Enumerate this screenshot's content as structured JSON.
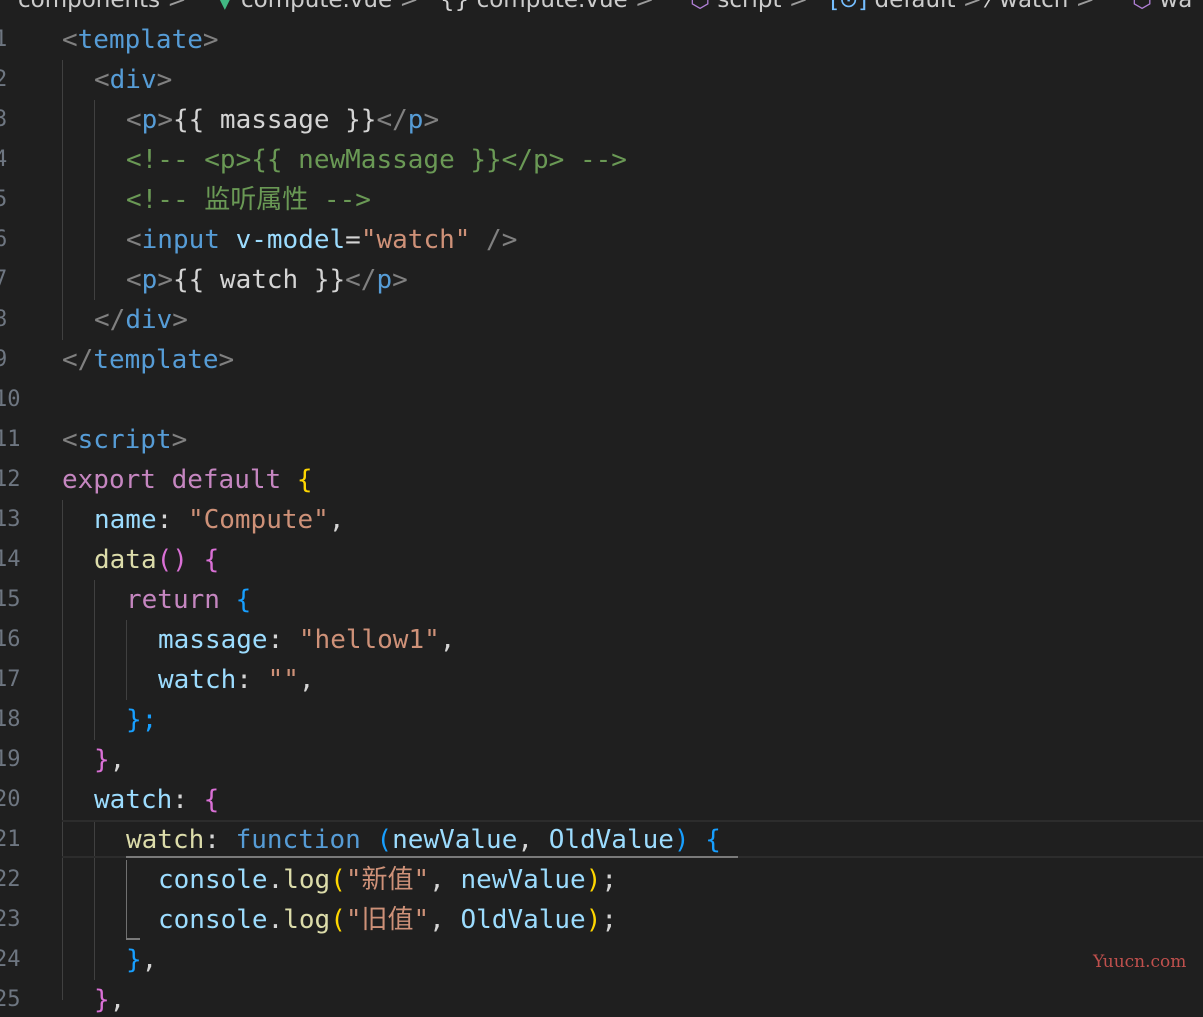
{
  "breadcrumb": {
    "items": [
      {
        "icon": "",
        "label": "components"
      },
      {
        "icon": "vue-logo-icon",
        "glyph": "▼",
        "label": "compute.vue"
      },
      {
        "icon": "braces-icon",
        "glyph": "{}",
        "label": "compute.vue"
      },
      {
        "icon": "cube-icon",
        "glyph": "⬡",
        "label": "script"
      },
      {
        "icon": "module-icon",
        "glyph": "[⊙]",
        "label": "default"
      },
      {
        "icon": "wrench-icon",
        "glyph": "⁄",
        "label": "watch"
      },
      {
        "icon": "cube-icon",
        "glyph": "⬡",
        "label": "wa"
      }
    ],
    "separator": ">"
  },
  "line_numbers": [
    "1",
    "2",
    "3",
    "4",
    "5",
    "6",
    "7",
    "8",
    "9",
    "10",
    "11",
    "12",
    "13",
    "14",
    "15",
    "16",
    "17",
    "18",
    "19",
    "20",
    "21",
    "22",
    "23",
    "24",
    "25"
  ],
  "code": {
    "l1": {
      "a": "<",
      "b": "template",
      "c": ">"
    },
    "l2": {
      "a": "<",
      "b": "div",
      "c": ">"
    },
    "l3": {
      "a": "<",
      "b": "p",
      "c": ">",
      "d": "{{ massage }}",
      "e": "</",
      "f": "p",
      "g": ">"
    },
    "l4": {
      "a": "<!-- <p>{{ newMassage }}</p> -->"
    },
    "l5": {
      "a": "<!-- 监听属性 -->"
    },
    "l6": {
      "a": "<",
      "b": "input",
      "c": " ",
      "d": "v-model",
      "e": "=",
      "f": "\"watch\"",
      "g": " />"
    },
    "l7": {
      "a": "<",
      "b": "p",
      "c": ">",
      "d": "{{ watch }}",
      "e": "</",
      "f": "p",
      "g": ">"
    },
    "l8": {
      "a": "</",
      "b": "div",
      "c": ">"
    },
    "l9": {
      "a": "</",
      "b": "template",
      "c": ">"
    },
    "l11": {
      "a": "<",
      "b": "script",
      "c": ">"
    },
    "l12": {
      "a": "export",
      "b": " ",
      "c": "default",
      "d": " ",
      "e": "{"
    },
    "l13": {
      "a": "name",
      "b": ": ",
      "c": "\"Compute\"",
      "d": ","
    },
    "l14": {
      "a": "data",
      "b": "()",
      "c": " ",
      "d": "{"
    },
    "l15": {
      "a": "return",
      "b": " ",
      "c": "{"
    },
    "l16": {
      "a": "massage",
      "b": ": ",
      "c": "\"hellow1\"",
      "d": ","
    },
    "l17": {
      "a": "watch",
      "b": ": ",
      "c": "\"\"",
      "d": ","
    },
    "l18": {
      "a": "};"
    },
    "l19": {
      "a": "}",
      "b": ","
    },
    "l20": {
      "a": "watch",
      "b": ": ",
      "c": "{"
    },
    "l21": {
      "a": "watch",
      "b": ": ",
      "c": "function",
      "d": " ",
      "e": "(",
      "f": "newValue",
      "g": ", ",
      "h": "OldValue",
      "i": ")",
      "j": " ",
      "k": "{"
    },
    "l22": {
      "a": "console",
      "b": ".",
      "c": "log",
      "d": "(",
      "e": "\"新值\"",
      "f": ", ",
      "g": "newValue",
      "h": ")",
      "i": ";"
    },
    "l23": {
      "a": "console",
      "b": ".",
      "c": "log",
      "d": "(",
      "e": "\"旧值\"",
      "f": ", ",
      "g": "OldValue",
      "h": ")",
      "i": ";"
    },
    "l24": {
      "a": "}",
      "b": ","
    },
    "l25": {
      "a": "}",
      "b": ","
    }
  },
  "watermark": "Yuucn.com",
  "colors": {
    "background": "#1f1f1f",
    "tag_bracket": "#808080",
    "tag_name": "#569cd6",
    "attribute": "#9cdcfe",
    "string": "#ce9178",
    "comment": "#6a9955",
    "keyword": "#c586c0",
    "function": "#dcdcaa",
    "bracket_gold": "#ffd700",
    "bracket_magenta": "#da70d6",
    "bracket_blue": "#179fff",
    "watermark": "#c0504d"
  }
}
